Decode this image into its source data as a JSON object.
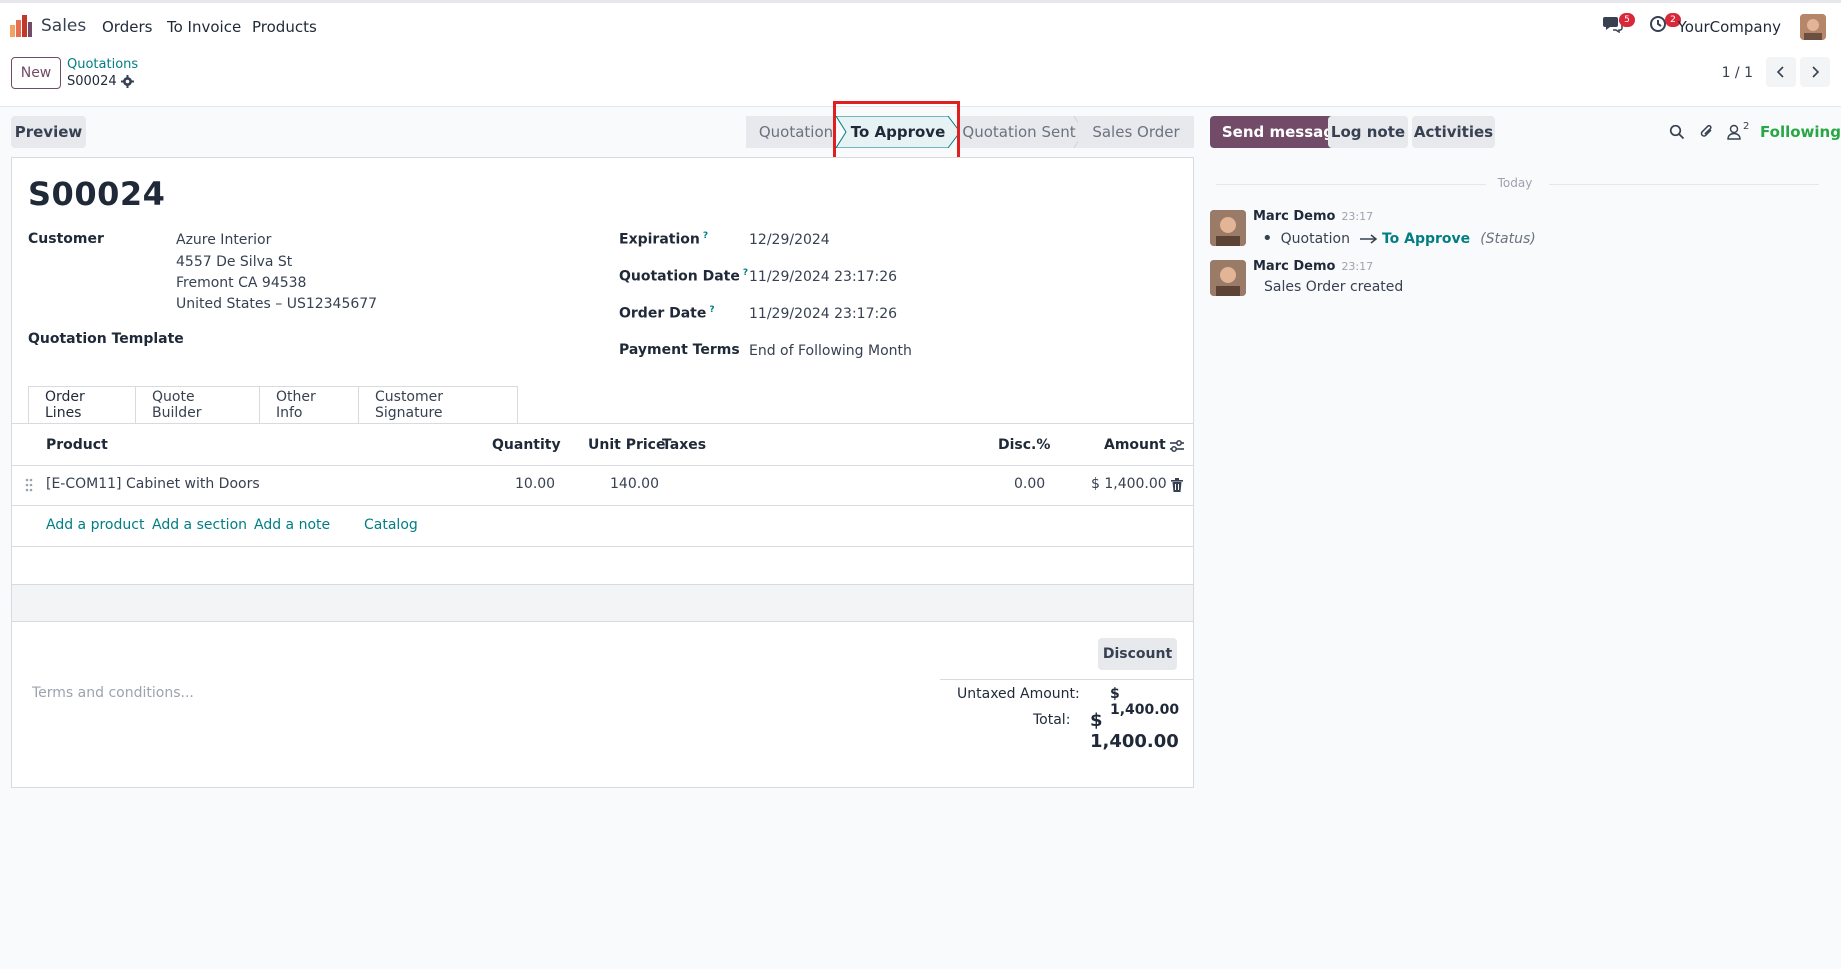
{
  "navbar": {
    "app_name": "Sales",
    "menu": [
      "Orders",
      "To Invoice",
      "Products"
    ],
    "messages_count": "5",
    "activities_count": "2",
    "company": "YourCompany"
  },
  "control": {
    "new_label": "New",
    "breadcrumb_parent": "Quotations",
    "breadcrumb_current": "S00024",
    "pager": "1 / 1"
  },
  "statusbar": {
    "preview_label": "Preview",
    "stages": [
      "Quotation",
      "To Approve",
      "Quotation Sent",
      "Sales Order"
    ],
    "active_stage": "To Approve"
  },
  "form": {
    "reference": "S00024",
    "customer_label": "Customer",
    "customer_name": "Azure Interior",
    "customer_address_1": "4557 De Silva St",
    "customer_address_2": "Fremont CA 94538",
    "customer_address_3": "United States – US12345677",
    "template_label": "Quotation Template",
    "expiration_label": "Expiration",
    "expiration_value": "12/29/2024",
    "quotation_date_label": "Quotation Date",
    "quotation_date_value": "11/29/2024 23:17:26",
    "order_date_label": "Order Date",
    "order_date_value": "11/29/2024 23:17:26",
    "payment_terms_label": "Payment Terms",
    "payment_terms_value": "End of Following Month",
    "help_mark": "?"
  },
  "tabs": [
    "Order Lines",
    "Quote Builder",
    "Other Info",
    "Customer Signature"
  ],
  "order_lines": {
    "headers": {
      "product": "Product",
      "quantity": "Quantity",
      "unit_price": "Unit Price",
      "taxes": "Taxes",
      "discount": "Disc.%",
      "amount": "Amount"
    },
    "rows": [
      {
        "product": "[E-COM11] Cabinet with Doors",
        "quantity": "10.00",
        "unit_price": "140.00",
        "taxes": "",
        "discount": "0.00",
        "amount": "$ 1,400.00"
      }
    ],
    "add_product": "Add a product",
    "add_section": "Add a section",
    "add_note": "Add a note",
    "catalog": "Catalog"
  },
  "footer": {
    "terms_placeholder": "Terms and conditions...",
    "discount_label": "Discount",
    "untaxed_label": "Untaxed Amount:",
    "untaxed_value": "$ 1,400.00",
    "total_label": "Total:",
    "total_value": "$ 1,400.00"
  },
  "chatter": {
    "send_message": "Send message",
    "log_note": "Log note",
    "activities": "Activities",
    "followers_count": "2",
    "following": "Following",
    "today": "Today",
    "messages": [
      {
        "author": "Marc Demo",
        "time": "23:17",
        "old_value": "Quotation",
        "new_value": "To Approve",
        "field": "(Status)"
      },
      {
        "author": "Marc Demo",
        "time": "23:17",
        "body": "Sales Order created"
      }
    ]
  },
  "colors": {
    "brand": "#714b67",
    "link": "#017e84",
    "active_stage_bg": "#e6f2f3",
    "highlight": "#e02020",
    "badge": "#d9283a",
    "following": "#28a745"
  }
}
